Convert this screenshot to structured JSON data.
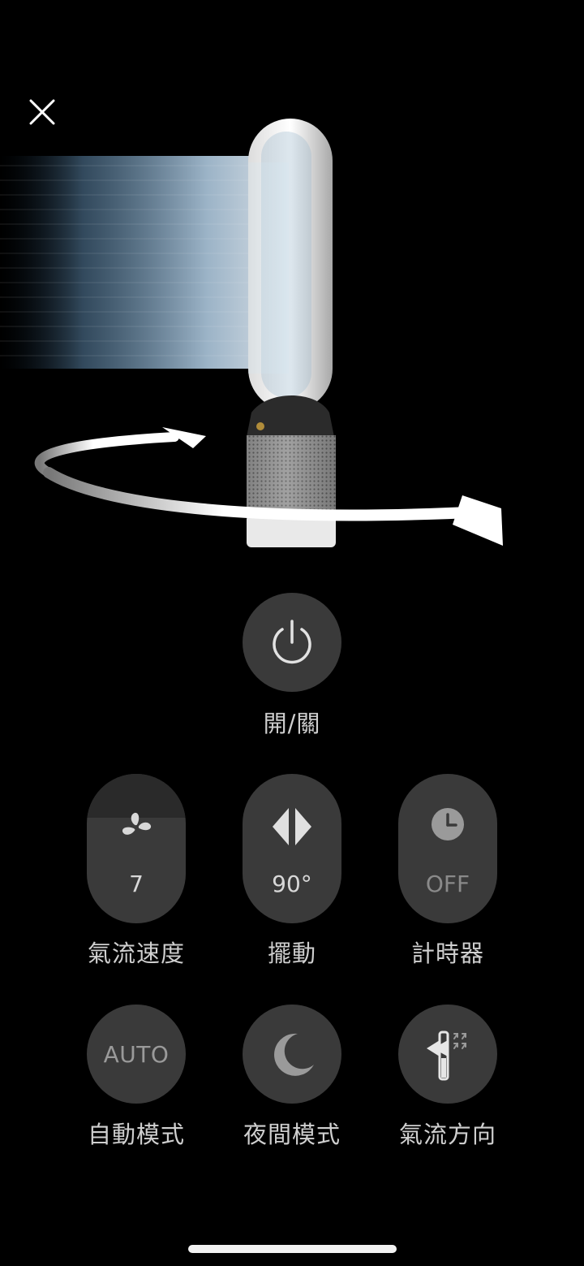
{
  "header": {
    "close_icon": "close-icon"
  },
  "power": {
    "label": "開/關",
    "icon": "power-icon"
  },
  "controls": {
    "fan_speed": {
      "label": "氣流速度",
      "value": "7",
      "icon": "fan-icon"
    },
    "oscillation": {
      "label": "擺動",
      "value": "90°",
      "icon": "oscillation-icon"
    },
    "timer": {
      "label": "計時器",
      "value": "OFF",
      "icon": "clock-icon"
    },
    "auto_mode": {
      "label": "自動模式",
      "text": "AUTO"
    },
    "night_mode": {
      "label": "夜間模式",
      "icon": "moon-icon"
    },
    "airflow_direction": {
      "label": "氣流方向",
      "icon": "airflow-direction-icon"
    }
  },
  "colors": {
    "background": "#000000",
    "button": "#3a3a3a",
    "label": "#cfcfcf"
  }
}
